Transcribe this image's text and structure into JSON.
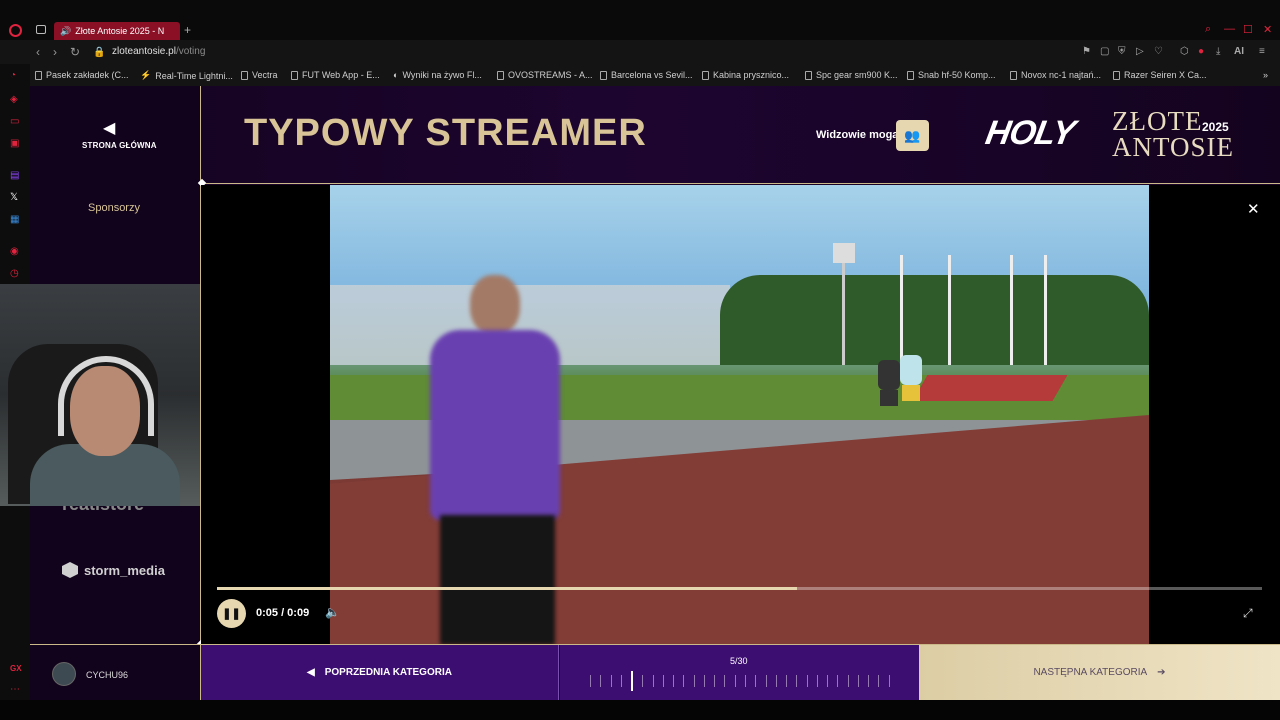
{
  "browser": {
    "tab_title": "Złote Antosie 2025 - N",
    "url_host": "zloteantosie.pl",
    "url_path": "/voting",
    "bookmarks": [
      "Pasek zakładek (C...",
      "Real-Time Lightni...",
      "Vectra",
      "FUT Web App - E...",
      "Wyniki na żywo Fl...",
      "OVOSTREAMS - A...",
      "Barcelona vs Sevil...",
      "Kabina prysznico...",
      "Spc gear sm900 K...",
      "Snab hf-50 Komp...",
      "Novox nc-1 najtań...",
      "Razer Seiren X Ca..."
    ],
    "ai_label": "AI"
  },
  "header": {
    "home_label": "STRONA GŁÓWNA",
    "category_title": "TYPOWY STREAMER",
    "viewers_label": "Widzowie mogą",
    "logo_holy": "HOLY",
    "logo_zlote": "ZŁOTE",
    "logo_antosie": "ANTOSIE",
    "logo_year": "2025"
  },
  "sidebar": {
    "sponsors_label": "Sponsorzy",
    "sponsor_partial": "reatistore",
    "sponsor_storm": "storm_media"
  },
  "player": {
    "time": "0:05 / 0:09",
    "progress": 0.555
  },
  "footer": {
    "username": "CYCHU96",
    "prev_label": "POPRZEDNIA KATEGORIA",
    "counter": "5/30",
    "current_index": 5,
    "total": 30,
    "next_label": "NASTĘPNA KATEGORIA"
  },
  "colors": {
    "accent_gold": "#e6d7b0",
    "title_gold": "#d8c496",
    "purple": "#3d0e72",
    "opera_red": "#e0233f"
  }
}
